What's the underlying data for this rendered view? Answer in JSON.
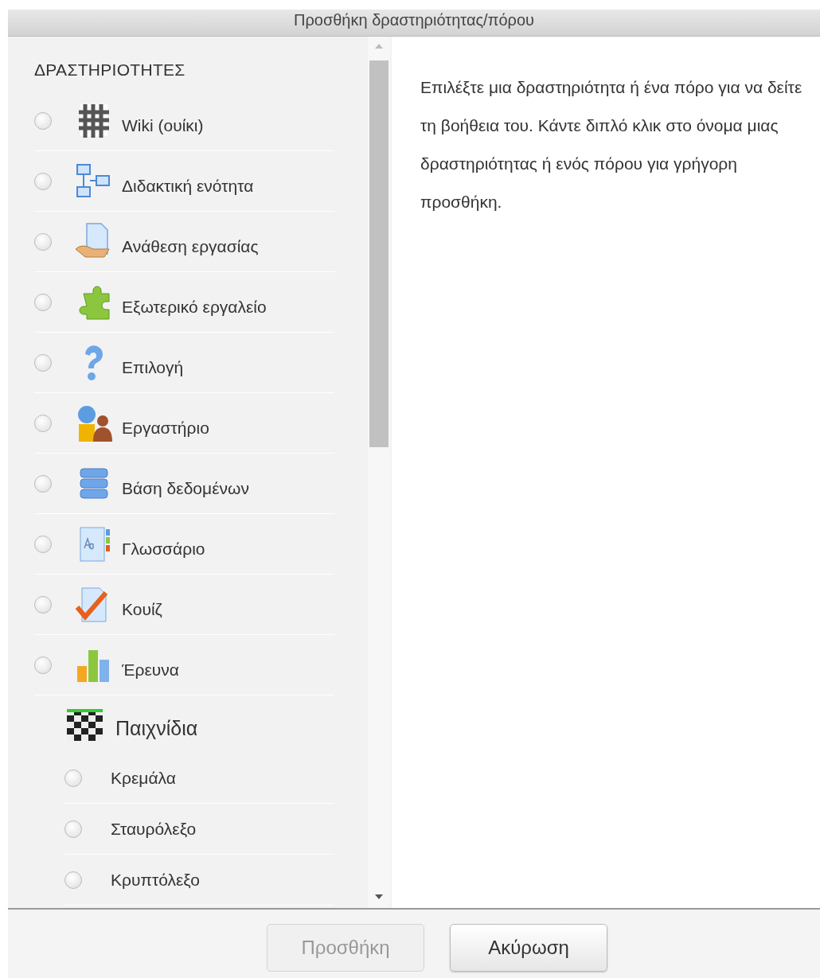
{
  "dialog": {
    "title": "Προσθήκη δραστηριότητας/πόρου"
  },
  "section_heading": "ΔΡΑΣΤΗΡΙΟΤΗΤΕΣ",
  "items": [
    {
      "kind": "option",
      "label": "Wiki (ουίκι)",
      "selected": false
    },
    {
      "kind": "option",
      "label": "Διδακτική ενότητα",
      "selected": false
    },
    {
      "kind": "option",
      "label": "Ανάθεση εργασίας",
      "selected": false
    },
    {
      "kind": "option",
      "label": "Εξωτερικό εργαλείο",
      "selected": false
    },
    {
      "kind": "option",
      "label": "Επιλογή",
      "selected": false
    },
    {
      "kind": "option",
      "label": "Εργαστήριο",
      "selected": false
    },
    {
      "kind": "option",
      "label": "Βάση δεδομένων",
      "selected": false
    },
    {
      "kind": "option",
      "label": "Γλωσσάριο",
      "selected": false
    },
    {
      "kind": "option",
      "label": "Κουίζ",
      "selected": false
    },
    {
      "kind": "option",
      "label": "Έρευνα",
      "selected": false
    },
    {
      "kind": "group",
      "label": "Παιχνίδια",
      "children": [
        {
          "label": "Κρεμάλα",
          "selected": false
        },
        {
          "label": "Σταυρόλεξο",
          "selected": false
        },
        {
          "label": "Κρυπτόλεξο",
          "selected": false
        }
      ]
    }
  ],
  "help_text": "Επιλέξτε μια δραστηριότητα ή ένα πόρο για να δείτε τη βοήθεια του. Κάντε διπλό κλικ στο όνομα μιας δραστηριότητας ή ενός πόρου για γρήγορη προσθήκη.",
  "buttons": [
    {
      "label": "Προσθήκη",
      "disabled": true
    },
    {
      "label": "Ακύρωση",
      "disabled": false
    }
  ]
}
